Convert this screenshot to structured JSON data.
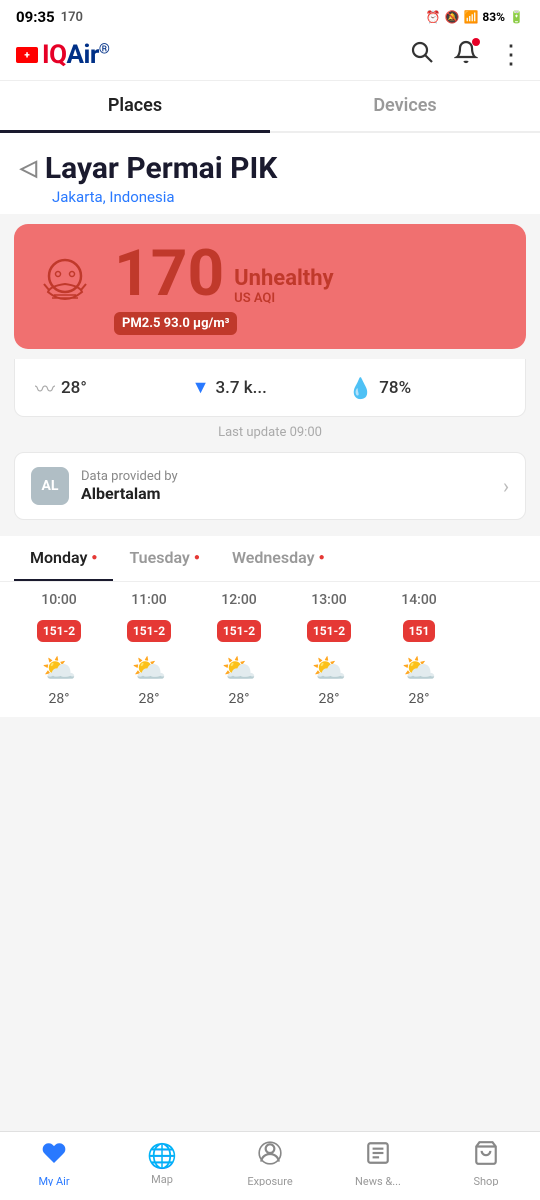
{
  "statusBar": {
    "time": "09:35",
    "extras": "170",
    "battery": "83%"
  },
  "header": {
    "logoText": "IQAir",
    "logoFlag": "+",
    "searchIcon": "🔍",
    "bellIcon": "🔔",
    "moreIcon": "⋮"
  },
  "tabs": {
    "places": "Places",
    "devices": "Devices"
  },
  "location": {
    "name": "Layar Permai PIK",
    "city": "Jakarta, Indonesia"
  },
  "aqi": {
    "number": "170",
    "unit": "US AQI",
    "status": "Unhealthy",
    "pm": "PM2.5  93.0 μg/m³"
  },
  "weather": {
    "temp": "28°",
    "windArrow": "▼",
    "windSpeed": "3.7 k...",
    "humidity": "78%"
  },
  "lastUpdate": "Last update 09:00",
  "provider": {
    "avatar": "AL",
    "label": "Data provided by",
    "name": "Albertalam"
  },
  "daysTabs": [
    {
      "label": "Monday",
      "dot": "●",
      "dotColor": "red",
      "active": true
    },
    {
      "label": "Tuesday",
      "dot": "●",
      "dotColor": "red",
      "active": false
    },
    {
      "label": "Wednesday",
      "dot": "●",
      "dotColor": "red",
      "active": false
    }
  ],
  "timeline": {
    "hours": [
      {
        "time": "10:00",
        "aqi": "151-2",
        "weather": "⛅",
        "temp": "28°"
      },
      {
        "time": "11:00",
        "aqi": "151-2",
        "weather": "⛅",
        "temp": "28°"
      },
      {
        "time": "12:00",
        "aqi": "151-2",
        "weather": "⛅",
        "temp": "28°"
      },
      {
        "time": "13:00",
        "aqi": "151-2",
        "weather": "⛅",
        "temp": "28°"
      },
      {
        "time": "14:00",
        "aqi": "151",
        "weather": "⛅",
        "temp": "28°"
      }
    ]
  },
  "bottomNav": [
    {
      "icon": "♥",
      "label": "My Air",
      "active": true
    },
    {
      "icon": "🌐",
      "label": "Map",
      "active": false
    },
    {
      "icon": "👤",
      "label": "Exposure",
      "active": false
    },
    {
      "icon": "📋",
      "label": "News &...",
      "active": false
    },
    {
      "icon": "🛒",
      "label": "Shop",
      "active": false
    }
  ],
  "sysNav": {
    "menu": "|||",
    "home": "○",
    "back": "‹"
  }
}
